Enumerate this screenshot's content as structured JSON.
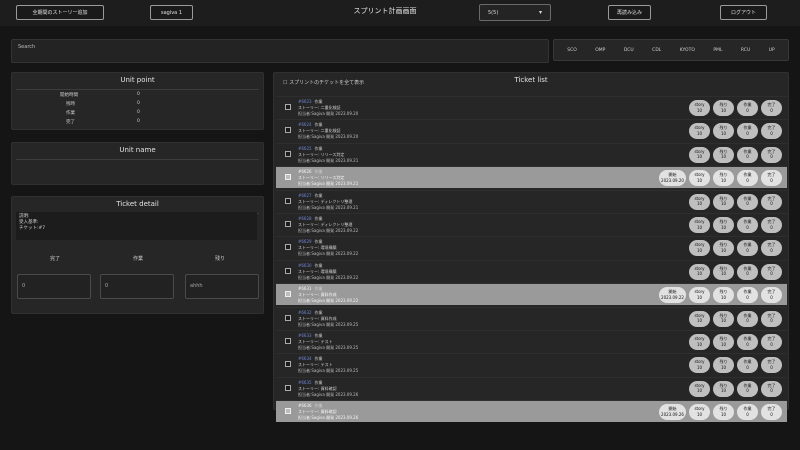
{
  "topbar": {
    "btn1": "全期間のストーリー追加",
    "btn2": "sagiva  1",
    "title": "スプリント計画画面",
    "sprint_value": "5(5)",
    "btn3": "再読み込み",
    "btn4": "ログアウト"
  },
  "search": {
    "placeholder": "Search"
  },
  "filters": [
    "SCO",
    "OMP",
    "DCU",
    "CDL",
    "KYOTO",
    "PML",
    "RCU",
    "UP"
  ],
  "unit_point": {
    "title": "Unit point",
    "rows": [
      {
        "label": "開始時間",
        "value": "0"
      },
      {
        "label": "残時",
        "value": "0"
      },
      {
        "label": "作業",
        "value": "0"
      },
      {
        "label": "完了",
        "value": "0"
      }
    ]
  },
  "unit_name": {
    "title": "Unit name"
  },
  "ticket_detail": {
    "title": "Ticket detail",
    "lines": [
      "説明:",
      "受入基準:",
      "チケット:#7"
    ],
    "cols": [
      "完了",
      "作業",
      "残り"
    ],
    "inputs": [
      "0",
      "0",
      "ahhh"
    ]
  },
  "ticket_list": {
    "title": "Ticket list",
    "select_all": "スプリントのチケットを全て表示",
    "rows": [
      {
        "id": "#6623",
        "title": "作業",
        "l2": "ストーリー: 二重化検証",
        "l3": "担当者:Sagiva  開発  2023.09.20",
        "pills": [
          [
            "story",
            "10"
          ],
          [
            "残り",
            "10"
          ],
          [
            "作業",
            "0"
          ],
          [
            "完了",
            "0"
          ]
        ],
        "hl": false
      },
      {
        "id": "#6624",
        "title": "作業",
        "l2": "ストーリー: 二重化検証",
        "l3": "担当者:Sagiva  開発  2023.09.20",
        "pills": [
          [
            "story",
            "10"
          ],
          [
            "残り",
            "10"
          ],
          [
            "作業",
            "0"
          ],
          [
            "完了",
            "0"
          ]
        ],
        "hl": false
      },
      {
        "id": "#6625",
        "title": "作業",
        "l2": "ストーリー: リリース判定",
        "l3": "担当者:Sagiva  開発  2023.09.21",
        "pills": [
          [
            "story",
            "10"
          ],
          [
            "残り",
            "10"
          ],
          [
            "作業",
            "0"
          ],
          [
            "完了",
            "0"
          ]
        ],
        "hl": false
      },
      {
        "id": "#6626",
        "title": "作業",
        "l2": "ストーリー: リリース判定",
        "l3": "担当者:Sagiva  開発  2023.09.21",
        "pills": [
          [
            "開始",
            "2023.09.20"
          ],
          [
            "story",
            "10"
          ],
          [
            "残り",
            "10"
          ],
          [
            "作業",
            "0"
          ],
          [
            "完了",
            "0"
          ]
        ],
        "hl": true
      },
      {
        "id": "#6627",
        "title": "作業",
        "l2": "ストーリー: ディレクトリ整理",
        "l3": "担当者:Sagiva  開発  2023.09.21",
        "pills": [
          [
            "story",
            "10"
          ],
          [
            "残り",
            "10"
          ],
          [
            "作業",
            "0"
          ],
          [
            "完了",
            "0"
          ]
        ],
        "hl": false
      },
      {
        "id": "#6628",
        "title": "作業",
        "l2": "ストーリー: ディレクトリ整理",
        "l3": "担当者:Sagiva  開発  2023.09.22",
        "pills": [
          [
            "story",
            "10"
          ],
          [
            "残り",
            "10"
          ],
          [
            "作業",
            "0"
          ],
          [
            "完了",
            "0"
          ]
        ],
        "hl": false
      },
      {
        "id": "#6629",
        "title": "作業",
        "l2": "ストーリー: 環境構築",
        "l3": "担当者:Sagiva  開発  2023.09.22",
        "pills": [
          [
            "story",
            "10"
          ],
          [
            "残り",
            "10"
          ],
          [
            "作業",
            "0"
          ],
          [
            "完了",
            "0"
          ]
        ],
        "hl": false
      },
      {
        "id": "#6630",
        "title": "作業",
        "l2": "ストーリー: 環境構築",
        "l3": "担当者:Sagiva  開発  2023.09.22",
        "pills": [
          [
            "story",
            "10"
          ],
          [
            "残り",
            "10"
          ],
          [
            "作業",
            "0"
          ],
          [
            "完了",
            "0"
          ]
        ],
        "hl": false
      },
      {
        "id": "#6631",
        "title": "作業",
        "l2": "ストーリー: 資料作成",
        "l3": "担当者:Sagiva  開発  2023.09.22",
        "pills": [
          [
            "開始",
            "2023.09.22"
          ],
          [
            "story",
            "10"
          ],
          [
            "残り",
            "10"
          ],
          [
            "作業",
            "0"
          ],
          [
            "完了",
            "0"
          ]
        ],
        "hl": true
      },
      {
        "id": "#6632",
        "title": "作業",
        "l2": "ストーリー: 資料作成",
        "l3": "担当者:Sagiva  開発  2023.09.25",
        "pills": [
          [
            "story",
            "10"
          ],
          [
            "残り",
            "10"
          ],
          [
            "作業",
            "0"
          ],
          [
            "完了",
            "0"
          ]
        ],
        "hl": false
      },
      {
        "id": "#6633",
        "title": "作業",
        "l2": "ストーリー: テスト",
        "l3": "担当者:Sagiva  開発  2023.09.25",
        "pills": [
          [
            "story",
            "10"
          ],
          [
            "残り",
            "10"
          ],
          [
            "作業",
            "0"
          ],
          [
            "完了",
            "0"
          ]
        ],
        "hl": false
      },
      {
        "id": "#6634",
        "title": "作業",
        "l2": "ストーリー: テスト",
        "l3": "担当者:Sagiva  開発  2023.09.25",
        "pills": [
          [
            "story",
            "10"
          ],
          [
            "残り",
            "10"
          ],
          [
            "作業",
            "0"
          ],
          [
            "完了",
            "0"
          ]
        ],
        "hl": false
      },
      {
        "id": "#6635",
        "title": "作業",
        "l2": "ストーリー: 資料確認",
        "l3": "担当者:Sagiva  開発  2023.09.26",
        "pills": [
          [
            "story",
            "10"
          ],
          [
            "残り",
            "10"
          ],
          [
            "作業",
            "0"
          ],
          [
            "完了",
            "0"
          ]
        ],
        "hl": false
      },
      {
        "id": "#6636",
        "title": "作業",
        "l2": "ストーリー: 資料確認",
        "l3": "担当者:Sagiva  開発  2023.09.26",
        "pills": [
          [
            "開始",
            "2023.09.26"
          ],
          [
            "story",
            "10"
          ],
          [
            "残り",
            "10"
          ],
          [
            "作業",
            "0"
          ],
          [
            "完了",
            "0"
          ]
        ],
        "hl": true
      }
    ]
  }
}
